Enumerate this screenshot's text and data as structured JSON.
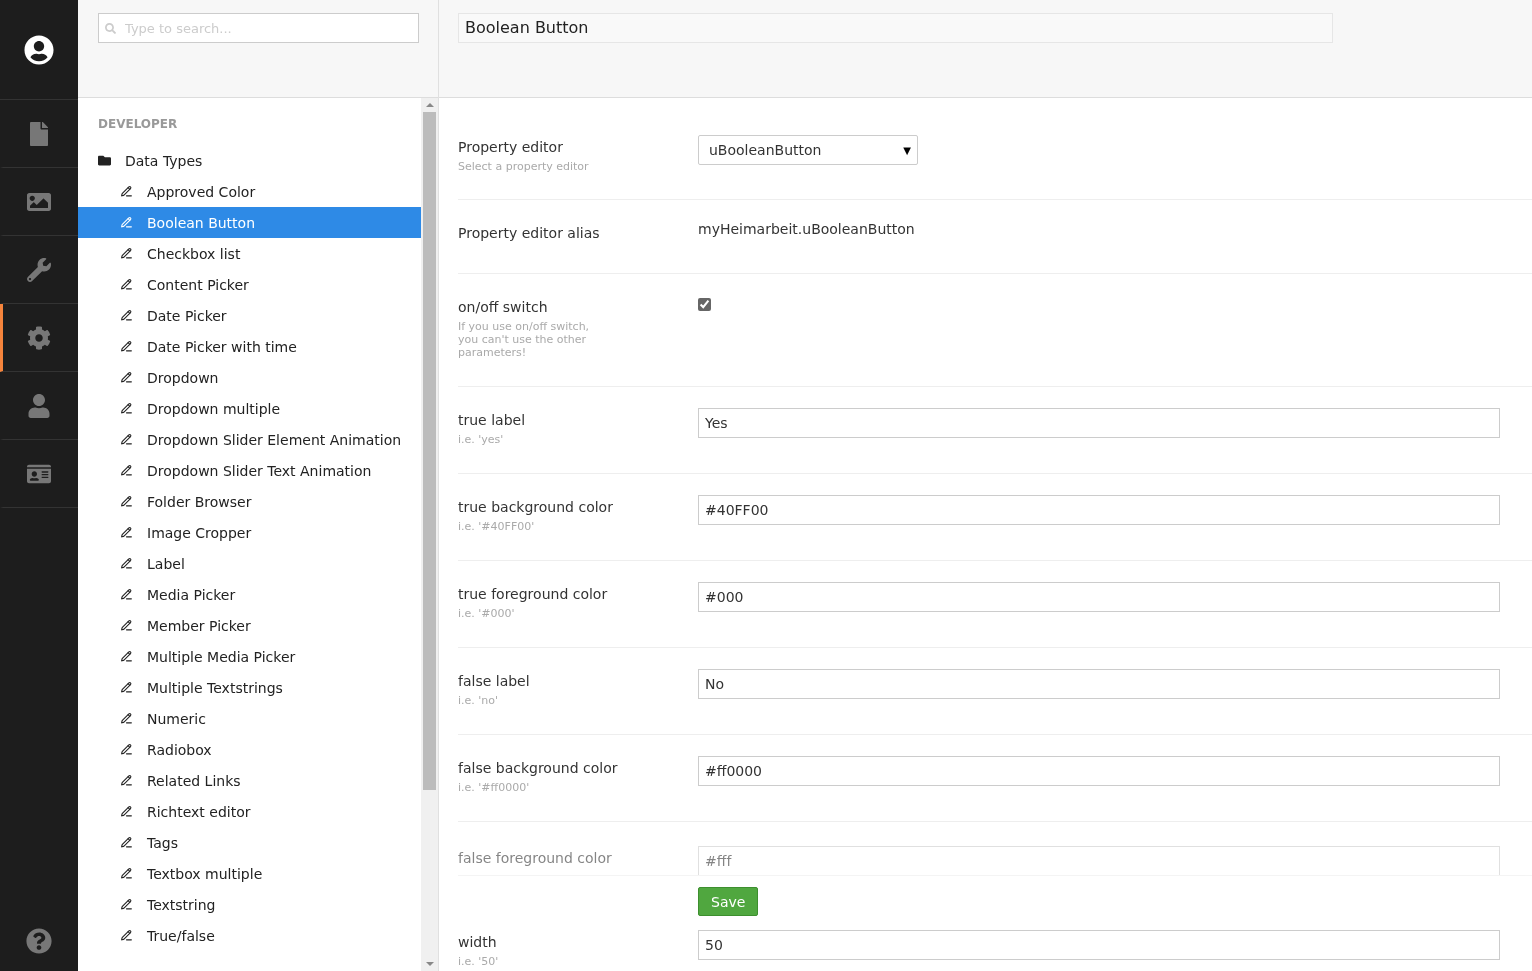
{
  "rail": {
    "items": [
      {
        "selected": false
      },
      {
        "selected": false
      },
      {
        "selected": false
      },
      {
        "selected": true
      },
      {
        "selected": false
      },
      {
        "selected": false
      }
    ]
  },
  "search": {
    "placeholder": "Type to search..."
  },
  "tree": {
    "section": "DEVELOPER",
    "folder": {
      "label": "Data Types",
      "children": [
        {
          "label": "Approved Color",
          "selected": false
        },
        {
          "label": "Boolean Button",
          "selected": true
        },
        {
          "label": "Checkbox list",
          "selected": false
        },
        {
          "label": "Content Picker",
          "selected": false
        },
        {
          "label": "Date Picker",
          "selected": false
        },
        {
          "label": "Date Picker with time",
          "selected": false
        },
        {
          "label": "Dropdown",
          "selected": false
        },
        {
          "label": "Dropdown multiple",
          "selected": false
        },
        {
          "label": "Dropdown Slider Element Animation",
          "selected": false
        },
        {
          "label": "Dropdown Slider Text Animation",
          "selected": false
        },
        {
          "label": "Folder Browser",
          "selected": false
        },
        {
          "label": "Image Cropper",
          "selected": false
        },
        {
          "label": "Label",
          "selected": false
        },
        {
          "label": "Media Picker",
          "selected": false
        },
        {
          "label": "Member Picker",
          "selected": false
        },
        {
          "label": "Multiple Media Picker",
          "selected": false
        },
        {
          "label": "Multiple Textstrings",
          "selected": false
        },
        {
          "label": "Numeric",
          "selected": false
        },
        {
          "label": "Radiobox",
          "selected": false
        },
        {
          "label": "Related Links",
          "selected": false
        },
        {
          "label": "Richtext editor",
          "selected": false
        },
        {
          "label": "Tags",
          "selected": false
        },
        {
          "label": "Textbox multiple",
          "selected": false
        },
        {
          "label": "Textstring",
          "selected": false
        },
        {
          "label": "True/false",
          "selected": false
        }
      ]
    }
  },
  "editor": {
    "name": "Boolean Button",
    "properties": [
      {
        "kind": "select",
        "label": "Property editor",
        "hint": "Select a property editor",
        "value": "uBooleanButton",
        "caret": "▼"
      },
      {
        "kind": "text",
        "label": "Property editor alias",
        "value": "myHeimarbeit.uBooleanButton"
      },
      {
        "kind": "checkbox",
        "label": "on/off switch",
        "hint": "If you use on/off switch, you can't use the other parameters!",
        "checked": true
      },
      {
        "kind": "input",
        "label": "true label",
        "hint": "i.e. 'yes'",
        "value": "Yes"
      },
      {
        "kind": "input",
        "label": "true background color",
        "hint": "i.e. '#40FF00'",
        "value": "#40FF00"
      },
      {
        "kind": "input",
        "label": "true foreground color",
        "hint": "i.e. '#000'",
        "value": "#000"
      },
      {
        "kind": "input",
        "label": "false label",
        "hint": "i.e. 'no'",
        "value": "No"
      },
      {
        "kind": "input",
        "label": "false background color",
        "hint": "i.e. '#ff0000'",
        "value": "#ff0000"
      },
      {
        "kind": "faded",
        "label": "false foreground color",
        "value": "#fff"
      }
    ],
    "save": "Save",
    "after": [
      {
        "kind": "input",
        "label": "width",
        "hint": "i.e. '50'",
        "value": "50"
      }
    ]
  }
}
